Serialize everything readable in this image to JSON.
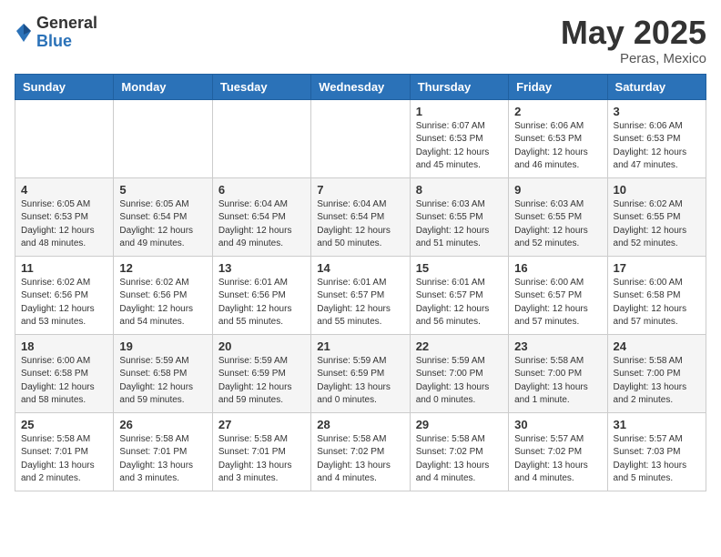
{
  "logo": {
    "general": "General",
    "blue": "Blue"
  },
  "title": "May 2025",
  "subtitle": "Peras, Mexico",
  "days": [
    "Sunday",
    "Monday",
    "Tuesday",
    "Wednesday",
    "Thursday",
    "Friday",
    "Saturday"
  ],
  "weeks": [
    [
      {
        "date": "",
        "info": ""
      },
      {
        "date": "",
        "info": ""
      },
      {
        "date": "",
        "info": ""
      },
      {
        "date": "",
        "info": ""
      },
      {
        "date": "1",
        "info": "Sunrise: 6:07 AM\nSunset: 6:53 PM\nDaylight: 12 hours\nand 45 minutes."
      },
      {
        "date": "2",
        "info": "Sunrise: 6:06 AM\nSunset: 6:53 PM\nDaylight: 12 hours\nand 46 minutes."
      },
      {
        "date": "3",
        "info": "Sunrise: 6:06 AM\nSunset: 6:53 PM\nDaylight: 12 hours\nand 47 minutes."
      }
    ],
    [
      {
        "date": "4",
        "info": "Sunrise: 6:05 AM\nSunset: 6:53 PM\nDaylight: 12 hours\nand 48 minutes."
      },
      {
        "date": "5",
        "info": "Sunrise: 6:05 AM\nSunset: 6:54 PM\nDaylight: 12 hours\nand 49 minutes."
      },
      {
        "date": "6",
        "info": "Sunrise: 6:04 AM\nSunset: 6:54 PM\nDaylight: 12 hours\nand 49 minutes."
      },
      {
        "date": "7",
        "info": "Sunrise: 6:04 AM\nSunset: 6:54 PM\nDaylight: 12 hours\nand 50 minutes."
      },
      {
        "date": "8",
        "info": "Sunrise: 6:03 AM\nSunset: 6:55 PM\nDaylight: 12 hours\nand 51 minutes."
      },
      {
        "date": "9",
        "info": "Sunrise: 6:03 AM\nSunset: 6:55 PM\nDaylight: 12 hours\nand 52 minutes."
      },
      {
        "date": "10",
        "info": "Sunrise: 6:02 AM\nSunset: 6:55 PM\nDaylight: 12 hours\nand 52 minutes."
      }
    ],
    [
      {
        "date": "11",
        "info": "Sunrise: 6:02 AM\nSunset: 6:56 PM\nDaylight: 12 hours\nand 53 minutes."
      },
      {
        "date": "12",
        "info": "Sunrise: 6:02 AM\nSunset: 6:56 PM\nDaylight: 12 hours\nand 54 minutes."
      },
      {
        "date": "13",
        "info": "Sunrise: 6:01 AM\nSunset: 6:56 PM\nDaylight: 12 hours\nand 55 minutes."
      },
      {
        "date": "14",
        "info": "Sunrise: 6:01 AM\nSunset: 6:57 PM\nDaylight: 12 hours\nand 55 minutes."
      },
      {
        "date": "15",
        "info": "Sunrise: 6:01 AM\nSunset: 6:57 PM\nDaylight: 12 hours\nand 56 minutes."
      },
      {
        "date": "16",
        "info": "Sunrise: 6:00 AM\nSunset: 6:57 PM\nDaylight: 12 hours\nand 57 minutes."
      },
      {
        "date": "17",
        "info": "Sunrise: 6:00 AM\nSunset: 6:58 PM\nDaylight: 12 hours\nand 57 minutes."
      }
    ],
    [
      {
        "date": "18",
        "info": "Sunrise: 6:00 AM\nSunset: 6:58 PM\nDaylight: 12 hours\nand 58 minutes."
      },
      {
        "date": "19",
        "info": "Sunrise: 5:59 AM\nSunset: 6:58 PM\nDaylight: 12 hours\nand 59 minutes."
      },
      {
        "date": "20",
        "info": "Sunrise: 5:59 AM\nSunset: 6:59 PM\nDaylight: 12 hours\nand 59 minutes."
      },
      {
        "date": "21",
        "info": "Sunrise: 5:59 AM\nSunset: 6:59 PM\nDaylight: 13 hours\nand 0 minutes."
      },
      {
        "date": "22",
        "info": "Sunrise: 5:59 AM\nSunset: 7:00 PM\nDaylight: 13 hours\nand 0 minutes."
      },
      {
        "date": "23",
        "info": "Sunrise: 5:58 AM\nSunset: 7:00 PM\nDaylight: 13 hours\nand 1 minute."
      },
      {
        "date": "24",
        "info": "Sunrise: 5:58 AM\nSunset: 7:00 PM\nDaylight: 13 hours\nand 2 minutes."
      }
    ],
    [
      {
        "date": "25",
        "info": "Sunrise: 5:58 AM\nSunset: 7:01 PM\nDaylight: 13 hours\nand 2 minutes."
      },
      {
        "date": "26",
        "info": "Sunrise: 5:58 AM\nSunset: 7:01 PM\nDaylight: 13 hours\nand 3 minutes."
      },
      {
        "date": "27",
        "info": "Sunrise: 5:58 AM\nSunset: 7:01 PM\nDaylight: 13 hours\nand 3 minutes."
      },
      {
        "date": "28",
        "info": "Sunrise: 5:58 AM\nSunset: 7:02 PM\nDaylight: 13 hours\nand 4 minutes."
      },
      {
        "date": "29",
        "info": "Sunrise: 5:58 AM\nSunset: 7:02 PM\nDaylight: 13 hours\nand 4 minutes."
      },
      {
        "date": "30",
        "info": "Sunrise: 5:57 AM\nSunset: 7:02 PM\nDaylight: 13 hours\nand 4 minutes."
      },
      {
        "date": "31",
        "info": "Sunrise: 5:57 AM\nSunset: 7:03 PM\nDaylight: 13 hours\nand 5 minutes."
      }
    ]
  ]
}
